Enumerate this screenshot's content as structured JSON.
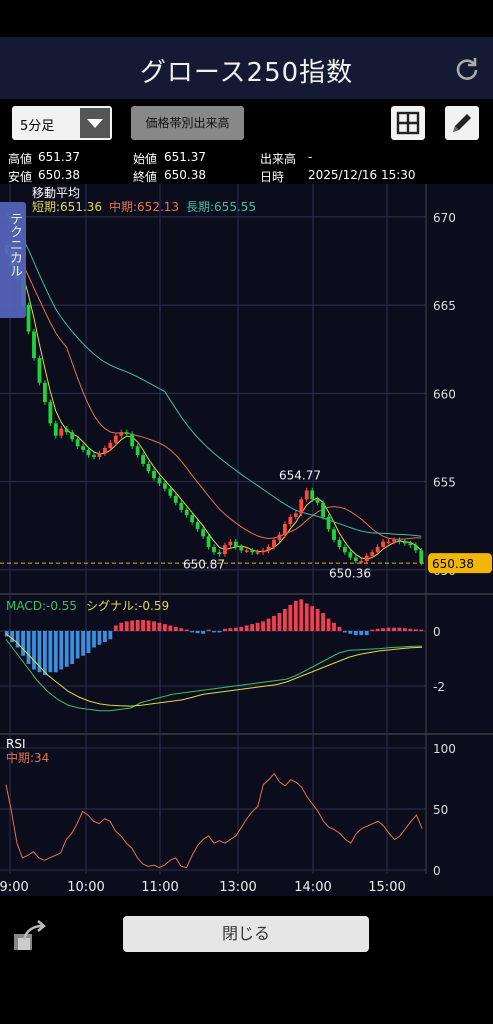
{
  "header": {
    "title": "グロース250指数",
    "refresh_icon": "refresh-icon"
  },
  "toolbar": {
    "interval_select": "5分足",
    "price_volume_button": "価格帯別出来高",
    "grid_icon": "grid-icon",
    "pencil_icon": "pencil-icon"
  },
  "quote": {
    "high_label": "高値",
    "high": "651.37",
    "open_label": "始値",
    "open": "651.37",
    "volume_label": "出来高",
    "volume": "-",
    "low_label": "安値",
    "low": "650.38",
    "close_label": "終値",
    "close": "650.38",
    "time_label": "日時",
    "time": "2025/12/16 15:30"
  },
  "side_tab": "テクニカル",
  "chart_data": [
    {
      "type": "candlestick",
      "overlay_title": "移動平均",
      "ma_labels": [
        {
          "label": "短期:651.36",
          "color": "#e0d84a"
        },
        {
          "label": "中期:652.13",
          "color": "#e0724f"
        },
        {
          "label": "長期:655.55",
          "color": "#3bbfa6"
        }
      ],
      "y_ticks": [
        "670",
        "665",
        "660",
        "655",
        "650"
      ],
      "ylim": [
        649.2,
        670.5
      ],
      "x_ticks": [
        "09:00",
        "10:00",
        "11:00",
        "13:00",
        "14:00",
        "15:00"
      ],
      "current_price": "650.38",
      "annotations": [
        {
          "text": "654.77",
          "value": 654.77
        },
        {
          "text": "650.87",
          "value": 650.87
        },
        {
          "text": "650.36",
          "value": 650.36
        }
      ],
      "up_color": "#ff4a3d",
      "down_color": "#22d23a",
      "closes": [
        668.0,
        667.2,
        666.5,
        665.0,
        663.5,
        662.0,
        660.6,
        659.5,
        658.3,
        657.6,
        658.0,
        657.8,
        657.4,
        657.0,
        656.8,
        656.5,
        656.4,
        656.6,
        656.9,
        657.2,
        657.6,
        657.8,
        657.7,
        657.0,
        656.5,
        656.0,
        655.6,
        655.2,
        654.9,
        654.6,
        654.2,
        653.8,
        653.4,
        653.1,
        652.7,
        652.3,
        651.9,
        651.3,
        651.0,
        650.9,
        651.4,
        651.6,
        651.3,
        651.1,
        651.1,
        651.0,
        651.0,
        651.1,
        651.3,
        651.7,
        652.0,
        652.6,
        653.0,
        653.2,
        654.0,
        654.5,
        654.0,
        653.8,
        653.0,
        652.3,
        651.7,
        651.3,
        651.0,
        650.7,
        650.5,
        650.5,
        650.8,
        651.0,
        651.3,
        651.6,
        651.6,
        651.7,
        651.6,
        651.5,
        651.4,
        651.1,
        650.4
      ]
    },
    {
      "type": "bar+line",
      "title": "MACD",
      "labels": [
        "MACD:-0.55",
        "シグナル:-0.59"
      ],
      "y_ticks": [
        "0",
        "-2"
      ],
      "ylim": [
        -3.6,
        1.2
      ],
      "positive_color": "#f04050",
      "negative_color": "#3a8fe0",
      "histogram": [
        -0.2,
        -0.4,
        -0.6,
        -0.9,
        -1.2,
        -1.4,
        -1.5,
        -1.6,
        -1.5,
        -1.5,
        -1.4,
        -1.3,
        -1.2,
        -1.0,
        -0.9,
        -0.8,
        -0.6,
        -0.5,
        -0.4,
        -0.3,
        0.2,
        0.3,
        0.35,
        0.38,
        0.4,
        0.4,
        0.38,
        0.35,
        0.3,
        0.25,
        0.2,
        0.15,
        0.1,
        0.05,
        -0.05,
        -0.08,
        -0.1,
        0.05,
        -0.05,
        -0.05,
        0.08,
        0.1,
        0.12,
        0.15,
        0.2,
        0.25,
        0.3,
        0.35,
        0.45,
        0.55,
        0.65,
        0.8,
        0.95,
        1.1,
        1.15,
        1.0,
        0.9,
        0.8,
        0.65,
        0.45,
        0.3,
        0.15,
        -0.05,
        -0.1,
        -0.15,
        -0.15,
        -0.15,
        0.05,
        0.08,
        0.1,
        0.12,
        0.12,
        0.12,
        0.1,
        0.08,
        0.06,
        0.05
      ],
      "macd_line": [
        -0.3,
        -0.8,
        -1.3,
        -1.8,
        -2.2,
        -2.5,
        -2.7,
        -2.8,
        -2.85,
        -2.9,
        -2.9,
        -2.85,
        -2.8,
        -2.6,
        -2.5,
        -2.4,
        -2.3,
        -2.25,
        -2.2,
        -2.15,
        -2.1,
        -2.05,
        -2.0,
        -1.95,
        -1.9,
        -1.85,
        -1.8,
        -1.75,
        -1.6,
        -1.4,
        -1.2,
        -1.0,
        -0.8,
        -0.7,
        -0.68,
        -0.66,
        -0.64,
        -0.6,
        -0.58,
        -0.56,
        -0.55
      ],
      "signal_line": [
        -0.1,
        -0.4,
        -0.8,
        -1.2,
        -1.6,
        -1.9,
        -2.2,
        -2.4,
        -2.55,
        -2.65,
        -2.7,
        -2.72,
        -2.73,
        -2.7,
        -2.65,
        -2.6,
        -2.55,
        -2.5,
        -2.4,
        -2.3,
        -2.25,
        -2.2,
        -2.15,
        -2.1,
        -2.05,
        -2.0,
        -1.95,
        -1.85,
        -1.7,
        -1.55,
        -1.4,
        -1.25,
        -1.1,
        -0.95,
        -0.85,
        -0.78,
        -0.72,
        -0.68,
        -0.64,
        -0.61,
        -0.59
      ]
    },
    {
      "type": "line",
      "title": "RSI",
      "labels": [
        "中期:34"
      ],
      "y_ticks": [
        "100",
        "50",
        "0"
      ],
      "ylim": [
        0,
        100
      ],
      "line_color": "#e0724f",
      "values": [
        70,
        48,
        22,
        10,
        12,
        15,
        10,
        8,
        10,
        12,
        14,
        25,
        30,
        38,
        48,
        45,
        40,
        38,
        42,
        40,
        32,
        28,
        22,
        18,
        10,
        5,
        3,
        4,
        2,
        4,
        8,
        10,
        3,
        2,
        12,
        20,
        25,
        28,
        22,
        24,
        22,
        25,
        28,
        35,
        42,
        48,
        52,
        70,
        74,
        79,
        72,
        69,
        74,
        72,
        68,
        60,
        54,
        48,
        40,
        35,
        33,
        30,
        25,
        22,
        30,
        34,
        36,
        38,
        40,
        36,
        30,
        25,
        28,
        34,
        40,
        45,
        34
      ]
    }
  ],
  "footer": {
    "close_button": "閉じる",
    "back_icon": "share-icon"
  }
}
